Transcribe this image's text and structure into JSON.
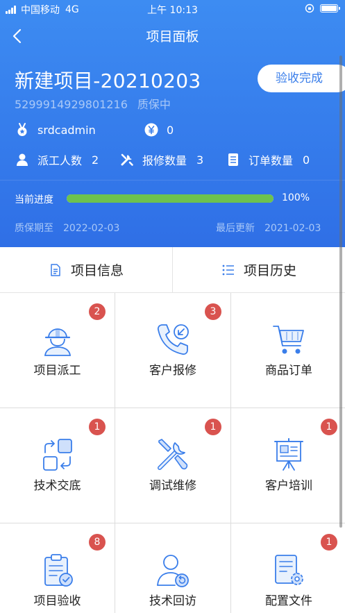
{
  "status_bar": {
    "carrier": "中国移动",
    "network": "4G",
    "time": "上午 10:13"
  },
  "nav": {
    "title": "项目面板"
  },
  "project": {
    "name": "新建项目-20210203",
    "code": "5299914929801216",
    "status": "质保中",
    "action_label": "验收完成",
    "user": "srdcadmin",
    "amount": "0",
    "workers_label": "派工人数",
    "workers_count": "2",
    "repairs_label": "报修数量",
    "repairs_count": "3",
    "orders_label": "订单数量",
    "orders_count": "0",
    "progress_label": "当前进度",
    "progress_value": 1.0,
    "progress_text": "100%",
    "warranty_label": "质保期至",
    "warranty_date": "2022-02-03",
    "updated_label": "最后更新",
    "updated_date": "2021-02-03"
  },
  "tabs": [
    {
      "label": "项目信息",
      "icon": "document-icon"
    },
    {
      "label": "项目历史",
      "icon": "list-icon"
    }
  ],
  "modules": [
    {
      "label": "项目派工",
      "badge": "2",
      "icon": "worker-helmet-icon"
    },
    {
      "label": "客户报修",
      "badge": "3",
      "icon": "phone-repair-icon"
    },
    {
      "label": "商品订单",
      "badge": "",
      "icon": "shopping-cart-icon"
    },
    {
      "label": "技术交底",
      "badge": "1",
      "icon": "exchange-icon"
    },
    {
      "label": "调试维修",
      "badge": "1",
      "icon": "tools-icon"
    },
    {
      "label": "客户培训",
      "badge": "1",
      "icon": "presentation-board-icon"
    },
    {
      "label": "项目验收",
      "badge": "8",
      "icon": "clipboard-check-icon"
    },
    {
      "label": "技术回访",
      "badge": "",
      "icon": "user-return-icon"
    },
    {
      "label": "配置文件",
      "badge": "1",
      "icon": "file-settings-icon"
    }
  ],
  "colors": {
    "header_blue": "#3a7eea",
    "progress_green": "#6dc24e",
    "badge_red": "#d9534f",
    "icon_blue": "#3a7eea"
  }
}
